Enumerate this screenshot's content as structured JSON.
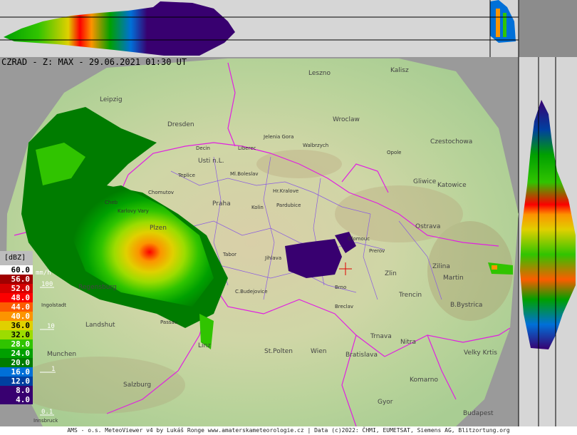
{
  "title": "CZRAD - Z: MAX - 29.06.2021 01:30 UT",
  "footer": "AMS - o.s. MeteoViewer v4 by Lukáš Ronge www.amaterskameteorologie.cz | Data (c)2022: ČHMI, EUMETSAT, Siemens AG, Blitzortung.org",
  "legend": {
    "unit": "[dBZ]",
    "levels": [
      {
        "label": "60.0",
        "color": "#ffffff"
      },
      {
        "label": "56.0",
        "color": "#a00000"
      },
      {
        "label": "52.0",
        "color": "#d40000"
      },
      {
        "label": "48.0",
        "color": "#fc0000"
      },
      {
        "label": "44.0",
        "color": "#fc5c00"
      },
      {
        "label": "40.0",
        "color": "#fc9400"
      },
      {
        "label": "36.0",
        "color": "#e0d000"
      },
      {
        "label": "32.0",
        "color": "#9cdc00"
      },
      {
        "label": "28.0",
        "color": "#30c400"
      },
      {
        "label": "24.0",
        "color": "#00a000"
      },
      {
        "label": "20.0",
        "color": "#007c00"
      },
      {
        "label": "16.0",
        "color": "#0070d8"
      },
      {
        "label": "12.0",
        "color": "#0040a0"
      },
      {
        "label": "8.0",
        "color": "#380070"
      },
      {
        "label": "4.0",
        "color": "#380070"
      }
    ]
  },
  "rain_scale": {
    "unit": "mm/h",
    "labels": [
      "100",
      "10",
      "1",
      "0.1"
    ]
  },
  "cities": [
    {
      "name": "Leszno"
    },
    {
      "name": "Kalisz"
    },
    {
      "name": "Leipzig"
    },
    {
      "name": "Wroclaw"
    },
    {
      "name": "Dresden"
    },
    {
      "name": "Jelenia Gora"
    },
    {
      "name": "Walbrzych"
    },
    {
      "name": "Czestochowa"
    },
    {
      "name": "Opole"
    },
    {
      "name": "Liberec"
    },
    {
      "name": "Usti n.L."
    },
    {
      "name": "Decin"
    },
    {
      "name": "Teplice"
    },
    {
      "name": "Ml.Boleslav"
    },
    {
      "name": "Gliwice"
    },
    {
      "name": "Katowice"
    },
    {
      "name": "Chomutov"
    },
    {
      "name": "Hr.Kralove"
    },
    {
      "name": "Pardubice"
    },
    {
      "name": "Praha"
    },
    {
      "name": "Kolin"
    },
    {
      "name": "Cheb"
    },
    {
      "name": "Karlovy Vary"
    },
    {
      "name": "Plzen"
    },
    {
      "name": "Ostrava"
    },
    {
      "name": "Olomouc"
    },
    {
      "name": "Prerov"
    },
    {
      "name": "Tabor"
    },
    {
      "name": "Jihlava"
    },
    {
      "name": "Zlin"
    },
    {
      "name": "Zilina"
    },
    {
      "name": "Martin"
    },
    {
      "name": "Regensburg"
    },
    {
      "name": "C.Budejovice"
    },
    {
      "name": "Brno"
    },
    {
      "name": "Ingolstadt"
    },
    {
      "name": "Trencin"
    },
    {
      "name": "B.Bystrica"
    },
    {
      "name": "Breclav"
    },
    {
      "name": "Landshut"
    },
    {
      "name": "Passau"
    },
    {
      "name": "Trnava"
    },
    {
      "name": "Nitra"
    },
    {
      "name": "Linz"
    },
    {
      "name": "Munchen"
    },
    {
      "name": "St.Polten"
    },
    {
      "name": "Wien"
    },
    {
      "name": "Bratislava"
    },
    {
      "name": "Velky Krtis"
    },
    {
      "name": "Salzburg"
    },
    {
      "name": "Komarno"
    },
    {
      "name": "Gyor"
    },
    {
      "name": "Budapest"
    },
    {
      "name": "Innsbruck"
    }
  ]
}
